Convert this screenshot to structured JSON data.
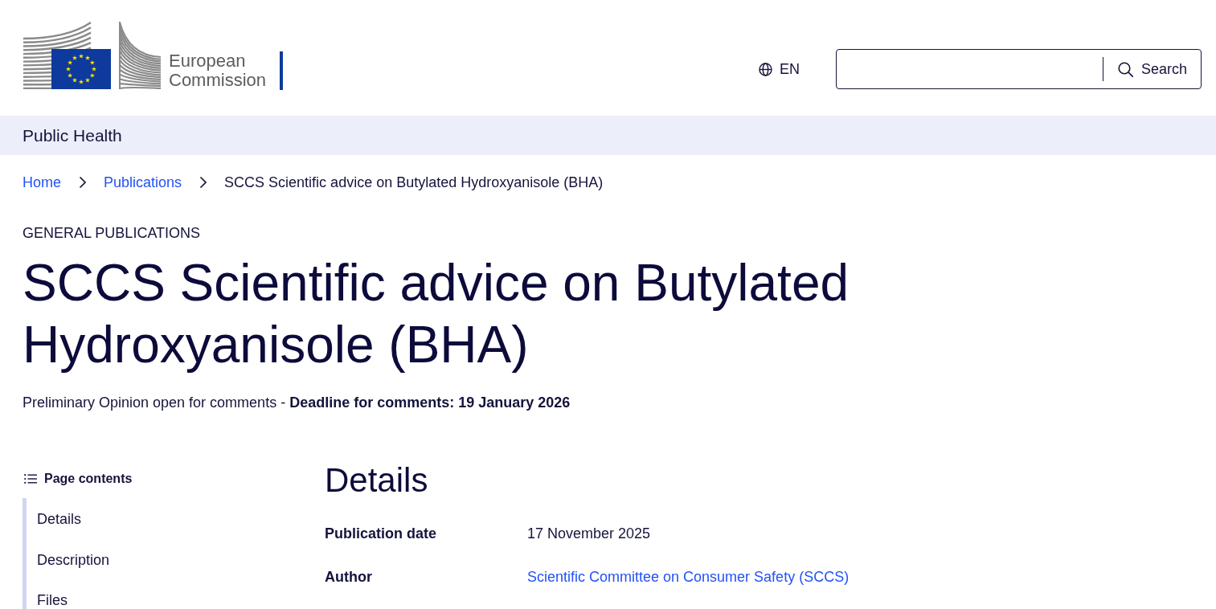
{
  "header": {
    "logo": {
      "text": "European Commission"
    },
    "language": {
      "code": "EN"
    },
    "search": {
      "button": "Search"
    }
  },
  "site_bar": {
    "name": "Public Health"
  },
  "breadcrumb": [
    {
      "label": "Home",
      "kind": "link"
    },
    {
      "label": "Publications",
      "kind": "link"
    },
    {
      "label": "SCCS Scientific advice on Butylated Hydroxyanisole (BHA)",
      "kind": "current"
    }
  ],
  "page_header": {
    "category": "GENERAL PUBLICATIONS",
    "title": "SCCS Scientific advice on Butylated Hydroxyanisole (BHA)",
    "description": "Preliminary Opinion open for comments - **Deadline for comments: 19 January 2026**"
  },
  "page_contents": {
    "title": "Page contents",
    "items": [
      {
        "label": "Details"
      },
      {
        "label": "Description"
      },
      {
        "label": "Files"
      }
    ]
  },
  "details": {
    "heading": "Details",
    "rows": [
      {
        "label": "Publication date",
        "value": "17 November 2025",
        "kind": "text"
      },
      {
        "label": "Author",
        "value": "Scientific Committee on Consumer Safety (SCCS)",
        "kind": "link"
      }
    ]
  }
}
